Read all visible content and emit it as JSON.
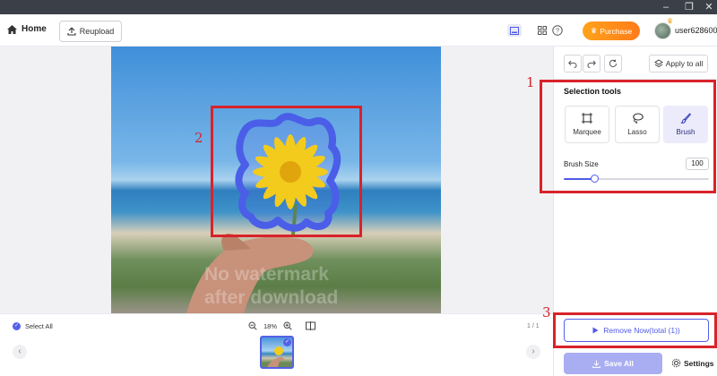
{
  "toolbar": {
    "home_label": "Home",
    "reupload_label": "Reupload",
    "purchase_label": "Purchase",
    "username": "user628600"
  },
  "canvas": {
    "watermark": [
      "No watermark",
      "after download"
    ],
    "annotations": [
      "1",
      "2",
      "3"
    ]
  },
  "bottom": {
    "select_all_label": "Select All",
    "zoom_level": "18%",
    "page_indicator": "1 / 1"
  },
  "panel": {
    "apply_all_label": "Apply to all",
    "selection_title": "Selection tools",
    "tools": [
      {
        "label": "Marquee",
        "icon": "marquee-icon",
        "active": false
      },
      {
        "label": "Lasso",
        "icon": "lasso-icon",
        "active": false
      },
      {
        "label": "Brush",
        "icon": "brush-icon",
        "active": true
      }
    ],
    "brush_size_label": "Brush Size",
    "brush_size_value": "100",
    "brush_slider_fraction": 0.21,
    "remove_label": "Remove Now(total (1))",
    "save_all_label": "Save All",
    "settings_label": "Settings"
  },
  "colors": {
    "accent": "#5560e8",
    "purchase": "#ff8c1a",
    "annotation": "#d8232a",
    "title_bar": "#3b3f48"
  }
}
